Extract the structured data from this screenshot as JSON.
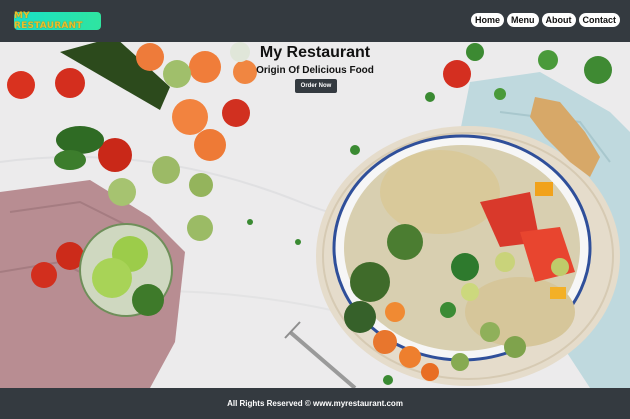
{
  "header": {
    "logo_text": "MY RESTAURANT",
    "nav": [
      {
        "label": "Home"
      },
      {
        "label": "Menu"
      },
      {
        "label": "About"
      },
      {
        "label": "Contact"
      }
    ]
  },
  "hero": {
    "title": "My Restaurant",
    "subtitle": "Origin Of Delicious Food",
    "button_label": "Order Now"
  },
  "footer": {
    "text": "All Rights Reserved © www.myrestaurant.com"
  },
  "colors": {
    "bar": "#343a40",
    "logo_gradient_start": "#19e0c8",
    "logo_text": "#e7c12d"
  }
}
